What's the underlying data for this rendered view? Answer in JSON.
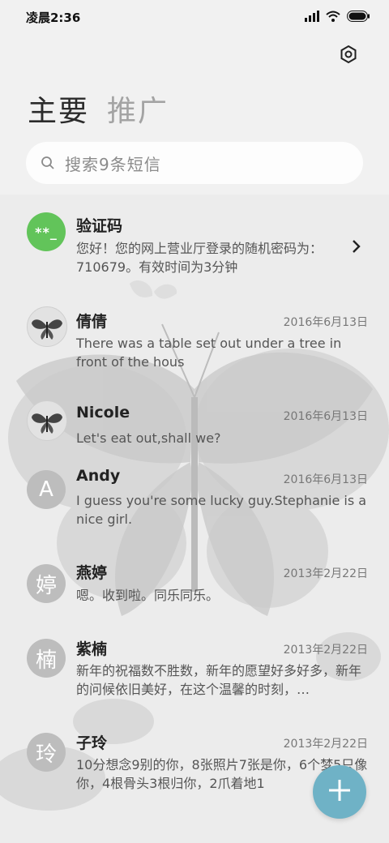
{
  "status": {
    "time": "凌晨2:36"
  },
  "icons": {
    "signal": "signal-icon",
    "wifi": "wifi-icon",
    "battery": "battery-icon",
    "settings": "settings-icon",
    "search": "search-icon",
    "add": "plus-icon",
    "chevron": "chevron-right-icon"
  },
  "tabs": [
    {
      "label": "主要",
      "active": true
    },
    {
      "label": "推广",
      "active": false
    }
  ],
  "search": {
    "placeholder": "搜索9条短信"
  },
  "conversations": [
    {
      "name": "验证码",
      "avatar_text": "**_",
      "date": "",
      "preview": "您好！您的网上营业厅登录的随机密码为：710679。有效时间为3分钟"
    },
    {
      "name": "倩倩",
      "avatar_text": "",
      "date": "2016年6月13日",
      "preview": "There was a table set out under a tree in front of the hous"
    },
    {
      "name": "Nicole",
      "avatar_text": "",
      "date": "2016年6月13日",
      "preview": "Let's eat out,shall we?"
    },
    {
      "name": "Andy",
      "avatar_text": "A",
      "date": "2016年6月13日",
      "preview": "I guess you're some lucky guy.Stephanie is a nice girl."
    },
    {
      "name": "燕婷",
      "avatar_text": "婷",
      "date": "2013年2月22日",
      "preview": "嗯。收到啦。同乐同乐。"
    },
    {
      "name": "紫楠",
      "avatar_text": "楠",
      "date": "2013年2月22日",
      "preview": "新年的祝福数不胜数，新年的愿望好多好多，新年的问候依旧美好，在这个温馨的时刻，…"
    },
    {
      "name": "子玲",
      "avatar_text": "玲",
      "date": "2013年2月22日",
      "preview": "10分想念9别的你，8张照片7张是你，6个梦5只像你，4根骨头3根归你，2爪着地1"
    }
  ],
  "colors": {
    "accent": "#6fb2c6",
    "code_avatar": "#62c45a",
    "letter_avatar": "#bdbdbd"
  }
}
